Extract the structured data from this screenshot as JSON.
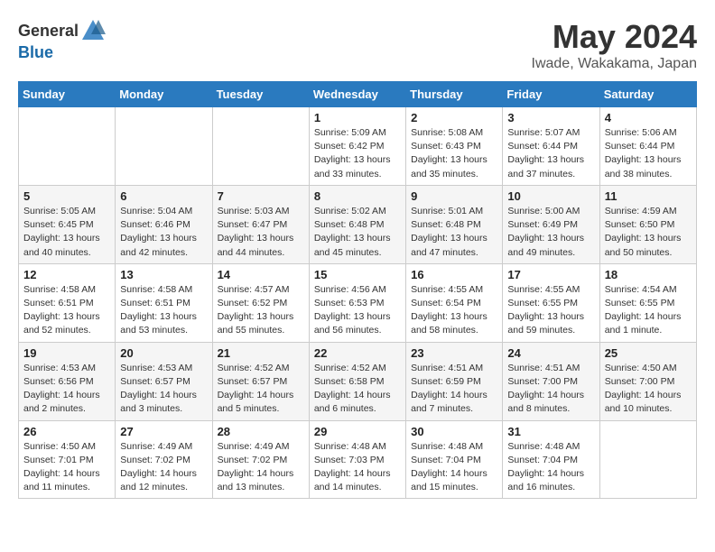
{
  "header": {
    "logo_general": "General",
    "logo_blue": "Blue",
    "month": "May 2024",
    "location": "Iwade, Wakakama, Japan"
  },
  "weekdays": [
    "Sunday",
    "Monday",
    "Tuesday",
    "Wednesday",
    "Thursday",
    "Friday",
    "Saturday"
  ],
  "weeks": [
    [
      {
        "day": "",
        "info": ""
      },
      {
        "day": "",
        "info": ""
      },
      {
        "day": "",
        "info": ""
      },
      {
        "day": "1",
        "info": "Sunrise: 5:09 AM\nSunset: 6:42 PM\nDaylight: 13 hours\nand 33 minutes."
      },
      {
        "day": "2",
        "info": "Sunrise: 5:08 AM\nSunset: 6:43 PM\nDaylight: 13 hours\nand 35 minutes."
      },
      {
        "day": "3",
        "info": "Sunrise: 5:07 AM\nSunset: 6:44 PM\nDaylight: 13 hours\nand 37 minutes."
      },
      {
        "day": "4",
        "info": "Sunrise: 5:06 AM\nSunset: 6:44 PM\nDaylight: 13 hours\nand 38 minutes."
      }
    ],
    [
      {
        "day": "5",
        "info": "Sunrise: 5:05 AM\nSunset: 6:45 PM\nDaylight: 13 hours\nand 40 minutes."
      },
      {
        "day": "6",
        "info": "Sunrise: 5:04 AM\nSunset: 6:46 PM\nDaylight: 13 hours\nand 42 minutes."
      },
      {
        "day": "7",
        "info": "Sunrise: 5:03 AM\nSunset: 6:47 PM\nDaylight: 13 hours\nand 44 minutes."
      },
      {
        "day": "8",
        "info": "Sunrise: 5:02 AM\nSunset: 6:48 PM\nDaylight: 13 hours\nand 45 minutes."
      },
      {
        "day": "9",
        "info": "Sunrise: 5:01 AM\nSunset: 6:48 PM\nDaylight: 13 hours\nand 47 minutes."
      },
      {
        "day": "10",
        "info": "Sunrise: 5:00 AM\nSunset: 6:49 PM\nDaylight: 13 hours\nand 49 minutes."
      },
      {
        "day": "11",
        "info": "Sunrise: 4:59 AM\nSunset: 6:50 PM\nDaylight: 13 hours\nand 50 minutes."
      }
    ],
    [
      {
        "day": "12",
        "info": "Sunrise: 4:58 AM\nSunset: 6:51 PM\nDaylight: 13 hours\nand 52 minutes."
      },
      {
        "day": "13",
        "info": "Sunrise: 4:58 AM\nSunset: 6:51 PM\nDaylight: 13 hours\nand 53 minutes."
      },
      {
        "day": "14",
        "info": "Sunrise: 4:57 AM\nSunset: 6:52 PM\nDaylight: 13 hours\nand 55 minutes."
      },
      {
        "day": "15",
        "info": "Sunrise: 4:56 AM\nSunset: 6:53 PM\nDaylight: 13 hours\nand 56 minutes."
      },
      {
        "day": "16",
        "info": "Sunrise: 4:55 AM\nSunset: 6:54 PM\nDaylight: 13 hours\nand 58 minutes."
      },
      {
        "day": "17",
        "info": "Sunrise: 4:55 AM\nSunset: 6:55 PM\nDaylight: 13 hours\nand 59 minutes."
      },
      {
        "day": "18",
        "info": "Sunrise: 4:54 AM\nSunset: 6:55 PM\nDaylight: 14 hours\nand 1 minute."
      }
    ],
    [
      {
        "day": "19",
        "info": "Sunrise: 4:53 AM\nSunset: 6:56 PM\nDaylight: 14 hours\nand 2 minutes."
      },
      {
        "day": "20",
        "info": "Sunrise: 4:53 AM\nSunset: 6:57 PM\nDaylight: 14 hours\nand 3 minutes."
      },
      {
        "day": "21",
        "info": "Sunrise: 4:52 AM\nSunset: 6:57 PM\nDaylight: 14 hours\nand 5 minutes."
      },
      {
        "day": "22",
        "info": "Sunrise: 4:52 AM\nSunset: 6:58 PM\nDaylight: 14 hours\nand 6 minutes."
      },
      {
        "day": "23",
        "info": "Sunrise: 4:51 AM\nSunset: 6:59 PM\nDaylight: 14 hours\nand 7 minutes."
      },
      {
        "day": "24",
        "info": "Sunrise: 4:51 AM\nSunset: 7:00 PM\nDaylight: 14 hours\nand 8 minutes."
      },
      {
        "day": "25",
        "info": "Sunrise: 4:50 AM\nSunset: 7:00 PM\nDaylight: 14 hours\nand 10 minutes."
      }
    ],
    [
      {
        "day": "26",
        "info": "Sunrise: 4:50 AM\nSunset: 7:01 PM\nDaylight: 14 hours\nand 11 minutes."
      },
      {
        "day": "27",
        "info": "Sunrise: 4:49 AM\nSunset: 7:02 PM\nDaylight: 14 hours\nand 12 minutes."
      },
      {
        "day": "28",
        "info": "Sunrise: 4:49 AM\nSunset: 7:02 PM\nDaylight: 14 hours\nand 13 minutes."
      },
      {
        "day": "29",
        "info": "Sunrise: 4:48 AM\nSunset: 7:03 PM\nDaylight: 14 hours\nand 14 minutes."
      },
      {
        "day": "30",
        "info": "Sunrise: 4:48 AM\nSunset: 7:04 PM\nDaylight: 14 hours\nand 15 minutes."
      },
      {
        "day": "31",
        "info": "Sunrise: 4:48 AM\nSunset: 7:04 PM\nDaylight: 14 hours\nand 16 minutes."
      },
      {
        "day": "",
        "info": ""
      }
    ]
  ]
}
